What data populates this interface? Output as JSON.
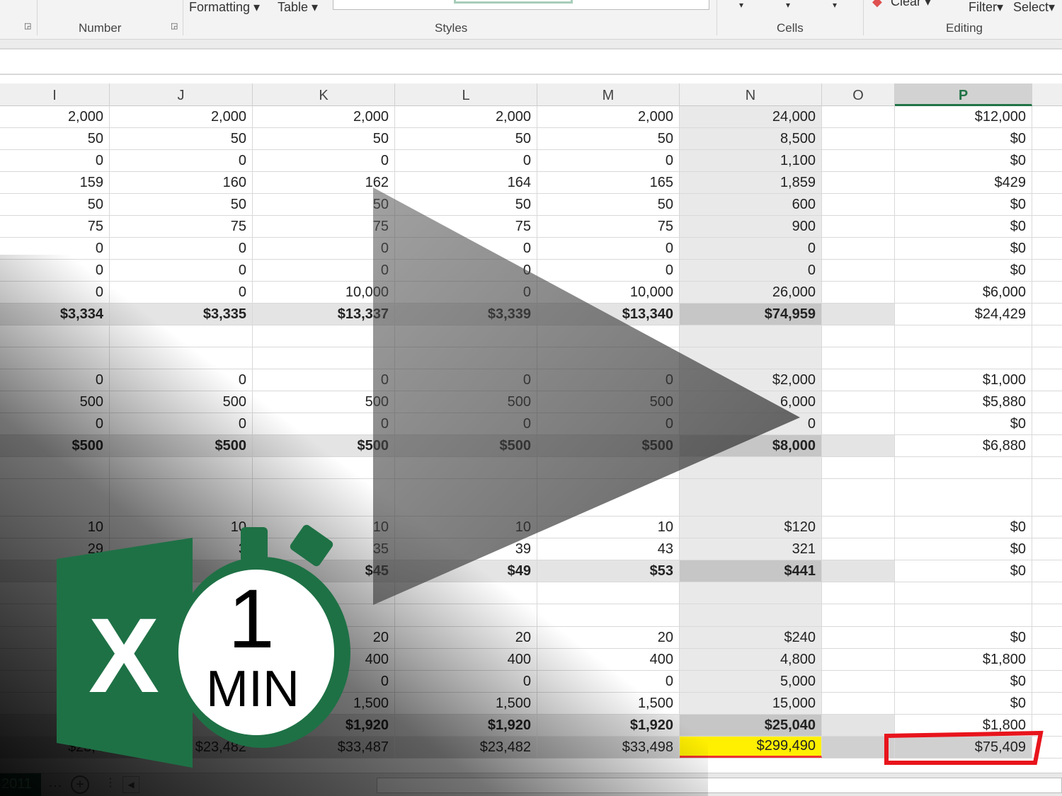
{
  "ribbon": {
    "formatting": "Formatting",
    "table": "Table",
    "groups": {
      "number": "Number",
      "styles": "Styles",
      "cells": "Cells",
      "editing": "Editing"
    },
    "clear": "Clear",
    "filter": "Filter",
    "select": "Select"
  },
  "columns": [
    "I",
    "J",
    "K",
    "L",
    "M",
    "N",
    "O",
    "P"
  ],
  "selected_column": "P",
  "rows": [
    {
      "type": "data",
      "v": [
        "2,000",
        "2,000",
        "2,000",
        "2,000",
        "2,000",
        "24,000",
        "",
        "$12,000"
      ]
    },
    {
      "type": "data",
      "v": [
        "50",
        "50",
        "50",
        "50",
        "50",
        "8,500",
        "",
        "$0"
      ]
    },
    {
      "type": "data",
      "v": [
        "0",
        "0",
        "0",
        "0",
        "0",
        "1,100",
        "",
        "$0"
      ]
    },
    {
      "type": "data",
      "v": [
        "159",
        "160",
        "162",
        "164",
        "165",
        "1,859",
        "",
        "$429"
      ]
    },
    {
      "type": "data",
      "v": [
        "50",
        "50",
        "50",
        "50",
        "50",
        "600",
        "",
        "$0"
      ]
    },
    {
      "type": "data",
      "v": [
        "75",
        "75",
        "75",
        "75",
        "75",
        "900",
        "",
        "$0"
      ]
    },
    {
      "type": "data",
      "v": [
        "0",
        "0",
        "0",
        "0",
        "0",
        "0",
        "",
        "$0"
      ]
    },
    {
      "type": "data",
      "v": [
        "0",
        "0",
        "0",
        "0",
        "0",
        "0",
        "",
        "$0"
      ]
    },
    {
      "type": "data",
      "v": [
        "0",
        "0",
        "10,000",
        "0",
        "10,000",
        "26,000",
        "",
        "$6,000"
      ]
    },
    {
      "type": "total",
      "v": [
        "$3,334",
        "$3,335",
        "$13,337",
        "$3,339",
        "$13,340",
        "$74,959",
        "",
        "$24,429"
      ]
    },
    {
      "type": "empty",
      "v": [
        "",
        "",
        "",
        "",
        "",
        "",
        "",
        ""
      ]
    },
    {
      "type": "empty",
      "v": [
        "",
        "",
        "",
        "",
        "",
        "",
        "",
        ""
      ]
    },
    {
      "type": "data",
      "v": [
        "0",
        "0",
        "0",
        "0",
        "0",
        "$2,000",
        "",
        "$1,000"
      ]
    },
    {
      "type": "data",
      "v": [
        "500",
        "500",
        "500",
        "500",
        "500",
        "6,000",
        "",
        "$5,880"
      ]
    },
    {
      "type": "data",
      "v": [
        "0",
        "0",
        "0",
        "0",
        "0",
        "0",
        "",
        "$0"
      ]
    },
    {
      "type": "total",
      "v": [
        "$500",
        "$500",
        "$500",
        "$500",
        "$500",
        "$8,000",
        "",
        "$6,880"
      ]
    },
    {
      "type": "empty",
      "v": [
        "",
        "",
        "",
        "",
        "",
        "",
        "",
        ""
      ]
    },
    {
      "type": "empty",
      "v": [
        "",
        "",
        "",
        "",
        "",
        "",
        "",
        ""
      ]
    },
    {
      "type": "data",
      "v": [
        "10",
        "10",
        "10",
        "10",
        "10",
        "$120",
        "",
        "$0"
      ]
    },
    {
      "type": "data",
      "v": [
        "29",
        "3",
        "35",
        "39",
        "43",
        "321",
        "",
        "$0"
      ]
    },
    {
      "type": "total",
      "v": [
        "",
        "",
        "$45",
        "$49",
        "$53",
        "$441",
        "",
        "$0"
      ]
    },
    {
      "type": "empty",
      "v": [
        "",
        "",
        "",
        "",
        "",
        "",
        "",
        ""
      ]
    },
    {
      "type": "empty",
      "v": [
        "",
        "",
        "",
        "",
        "",
        "",
        "",
        ""
      ]
    },
    {
      "type": "data",
      "v": [
        "",
        "",
        "20",
        "20",
        "20",
        "$240",
        "",
        "$0"
      ]
    },
    {
      "type": "data",
      "v": [
        "",
        "",
        "400",
        "400",
        "400",
        "4,800",
        "",
        "$1,800"
      ]
    },
    {
      "type": "data",
      "v": [
        "",
        "",
        "0",
        "0",
        "0",
        "5,000",
        "",
        "$0"
      ]
    },
    {
      "type": "data",
      "v": [
        "",
        "",
        "1,500",
        "1,500",
        "1,500",
        "15,000",
        "",
        "$0"
      ]
    },
    {
      "type": "total",
      "v": [
        "",
        "",
        "$1,920",
        "$1,920",
        "$1,920",
        "$25,040",
        "",
        "$1,800"
      ]
    },
    {
      "type": "grand",
      "v": [
        "$23,4",
        "$23,482",
        "$33,487",
        "$23,482",
        "$33,498",
        "$299,490",
        "",
        "$75,409"
      ]
    }
  ],
  "sheet_tab": "2011",
  "overlay": {
    "timer_number": "1",
    "timer_unit": "MIN",
    "logo_letter": "X"
  },
  "colors": {
    "excel_green": "#1e7145",
    "highlight_yellow": "#ffef00",
    "annotation_red": "#e8141c"
  }
}
